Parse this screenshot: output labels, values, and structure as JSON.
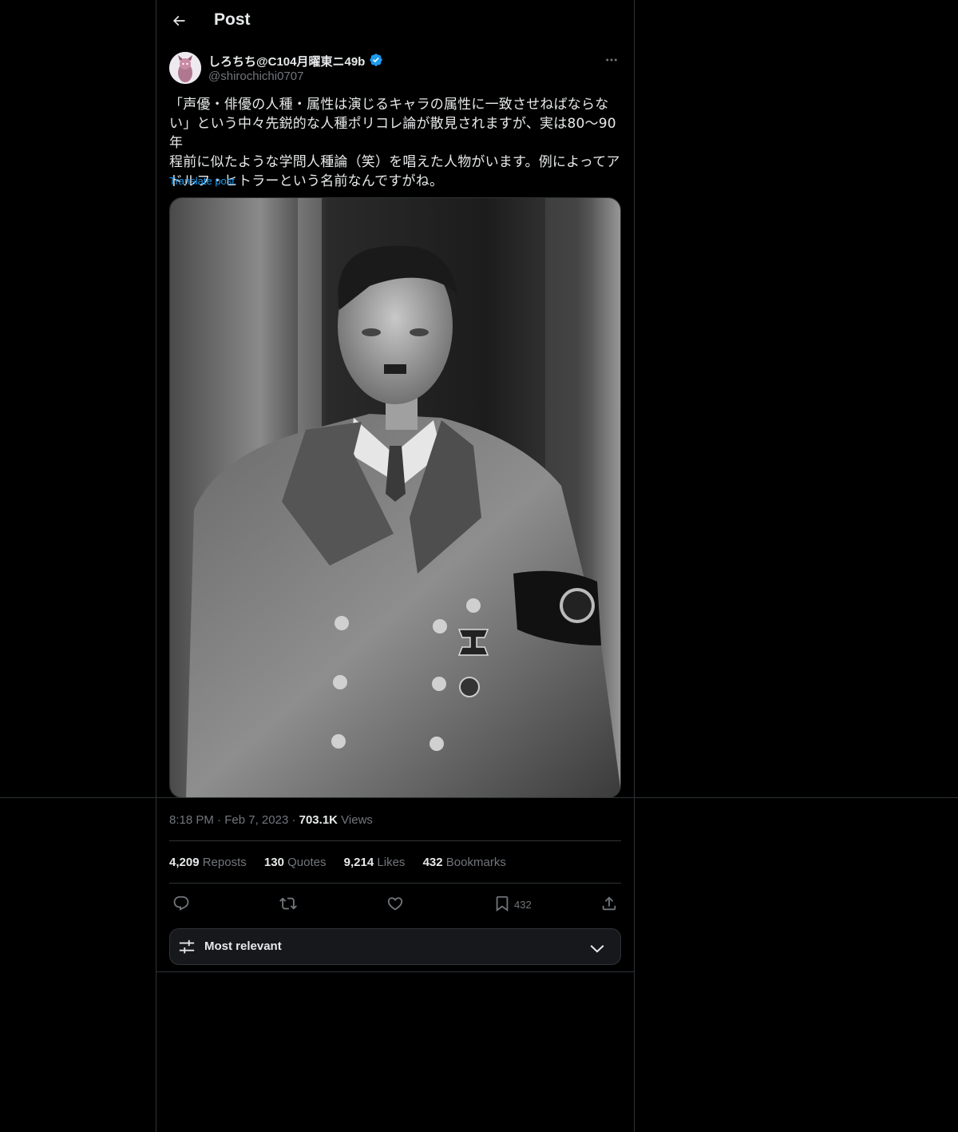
{
  "header": {
    "title": "Post"
  },
  "post": {
    "display_name": "しろちち@C104月曜東ニ49b",
    "handle": "@shirochichi0707",
    "text_lines": [
      "「声優・俳優の人種・属性は演じるキャラの属性に一致させねばならな",
      "い」という中々先鋭的な人種ポリコレ論が散見されますが、実は80〜90年",
      "程前に似たような学問人種論（笑）を唱えた人物がいます。例によってア",
      "ドルフ・ヒトラーという名前なんですがね。"
    ],
    "translate_label": "Translate post",
    "time": "8:18 PM",
    "date": "Feb 7, 2023",
    "views_count": "703.1K",
    "views_label": "Views"
  },
  "stats": {
    "reposts_count": "4,209",
    "reposts_label": "Reposts",
    "quotes_count": "130",
    "quotes_label": "Quotes",
    "likes_count": "9,214",
    "likes_label": "Likes",
    "bookmarks_count": "432",
    "bookmarks_label": "Bookmarks"
  },
  "actions": {
    "bookmark_count": "432"
  },
  "sort": {
    "label": "Most relevant"
  },
  "colors": {
    "accent": "#1d9bf0",
    "background": "#000000",
    "border": "#2f3336",
    "muted": "#71767b"
  },
  "icons": [
    "back-arrow-icon",
    "verified-badge-icon",
    "more-icon",
    "reply-icon",
    "repost-icon",
    "like-icon",
    "bookmark-icon",
    "share-icon",
    "sliders-icon",
    "chevron-down-icon"
  ]
}
